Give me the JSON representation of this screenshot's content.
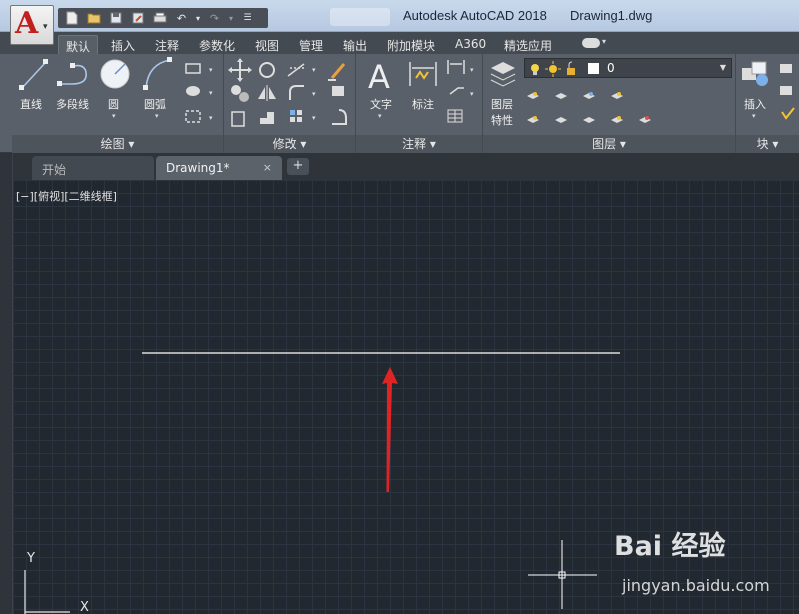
{
  "app": {
    "logo_letter": "A",
    "title": "Autodesk AutoCAD 2018",
    "document": "Drawing1.dwg"
  },
  "quick_access": {
    "icons": [
      "new-icon",
      "open-icon",
      "save-icon",
      "saveas-icon",
      "plot-icon",
      "undo-icon",
      "redo-icon",
      "customize-icon"
    ]
  },
  "ribbon_tabs": [
    "默认",
    "插入",
    "注释",
    "参数化",
    "视图",
    "管理",
    "输出",
    "附加模块",
    "A360",
    "精选应用"
  ],
  "ribbon_active_tab": "默认",
  "panels": {
    "draw": {
      "title": "绘图",
      "tools": [
        "直线",
        "多段线",
        "圆",
        "圆弧"
      ]
    },
    "modify": {
      "title": "修改"
    },
    "annotation": {
      "title": "注释",
      "tools": [
        "文字",
        "标注"
      ]
    },
    "layers": {
      "title": "图层",
      "properties_label_line1": "图层",
      "properties_label_line2": "特性",
      "current_layer": "0"
    },
    "block": {
      "title": "块",
      "insert_label": "插入"
    }
  },
  "file_tabs": {
    "start": "开始",
    "drawing": "Drawing1*",
    "close": "×",
    "add": "+"
  },
  "viewport": {
    "label": "[−][俯视][二维线框]",
    "ucs_y": "Y",
    "ucs_x": "X"
  },
  "colors": {
    "canvas_bg": "#212830",
    "line": "#ffffff",
    "arrow": "#e02424",
    "ribbon": "#5a6069"
  },
  "watermark": {
    "logo": "Bai 经验",
    "url": "jingyan.baidu.com"
  }
}
